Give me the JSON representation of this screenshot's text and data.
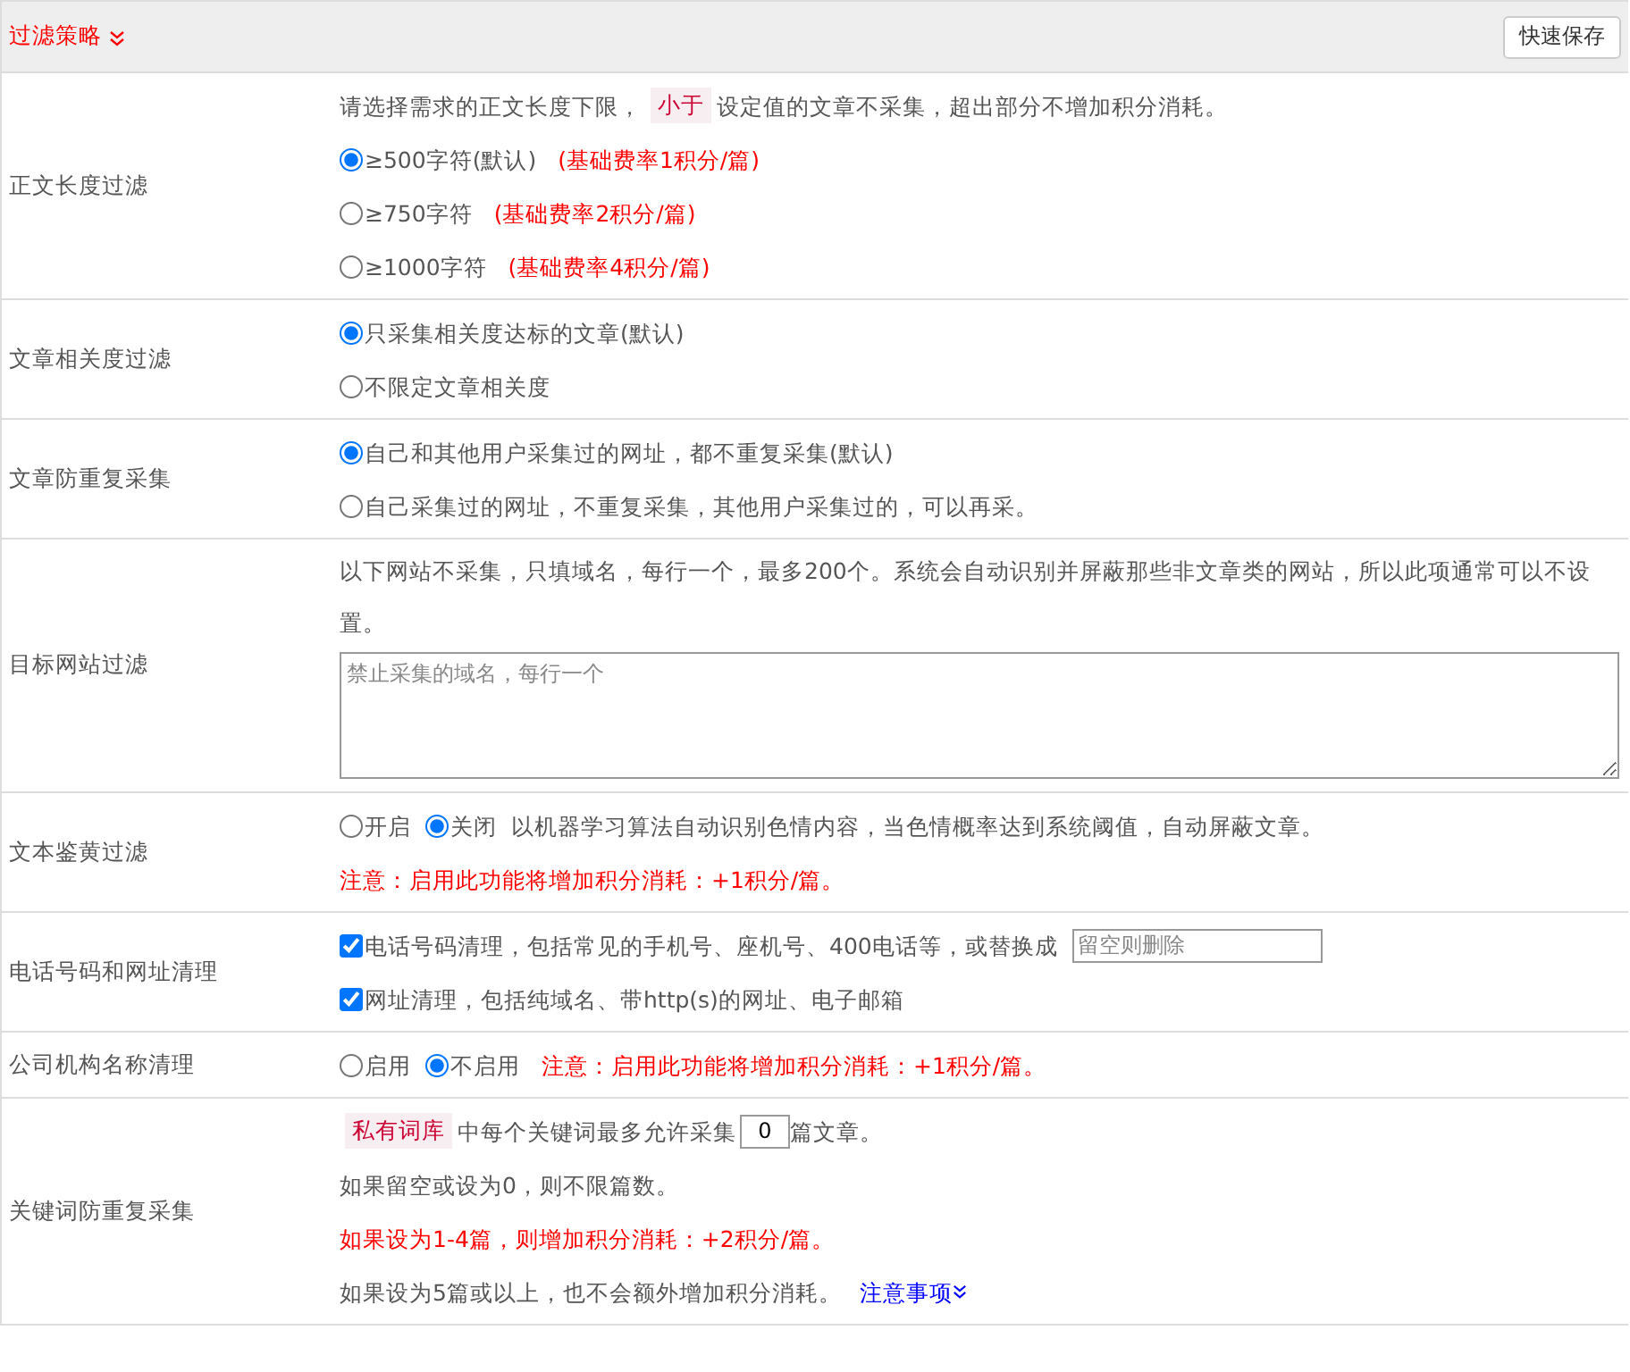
{
  "header": {
    "title": "过滤策略",
    "button": "快速保存"
  },
  "rows": [
    {
      "label": "正文长度过滤",
      "lines": [
        [
          {
            "kind": "text",
            "text": "请选择需求的正文长度下限，"
          },
          {
            "kind": "tag",
            "text": "小于"
          },
          {
            "kind": "text",
            "text": "设定值的文章不采集，超出部分不增加积分消耗。"
          }
        ],
        [
          {
            "kind": "radio",
            "text": "≥500字符(默认)",
            "selected": true
          },
          {
            "kind": "warning",
            "text": "(基础费率1积分/篇)"
          }
        ],
        [
          {
            "kind": "radio",
            "text": "≥750字符",
            "selected": false
          },
          {
            "kind": "warning",
            "text": "(基础费率2积分/篇)"
          }
        ],
        [
          {
            "kind": "radio",
            "text": "≥1000字符",
            "selected": false
          },
          {
            "kind": "warning",
            "text": "(基础费率4积分/篇)"
          }
        ]
      ]
    },
    {
      "label": "文章相关度过滤",
      "lines": [
        [
          {
            "kind": "radio",
            "text": "只采集相关度达标的文章(默认)",
            "selected": true
          }
        ],
        [
          {
            "kind": "radio",
            "text": "不限定文章相关度",
            "selected": false
          }
        ]
      ]
    },
    {
      "label": "文章防重复采集",
      "lines": [
        [
          {
            "kind": "radio",
            "text": "自己和其他用户采集过的网址，都不重复采集(默认)",
            "selected": true
          }
        ],
        [
          {
            "kind": "radio",
            "text": "自己采集过的网址，不重复采集，其他用户采集过的，可以再采。",
            "selected": false
          }
        ]
      ]
    },
    {
      "label": "目标网站过滤",
      "lines": [
        [
          {
            "kind": "text",
            "text": "以下网站不采集，只填域名，每行一个，最多200个。系统会自动识别并屏蔽那些非文章类的网站，所以此项通常可以不设置。"
          }
        ],
        [
          {
            "kind": "textarea",
            "placeholder": "禁止采集的域名，每行一个"
          }
        ]
      ]
    },
    {
      "label": "文本鉴黄过滤",
      "lines": [
        [
          {
            "kind": "radio",
            "text": "开启",
            "selected": false
          },
          {
            "kind": "radio",
            "text": "关闭",
            "selected": true
          },
          {
            "kind": "text",
            "text": "以机器学习算法自动识别色情内容，当色情概率达到系统阈值，自动屏蔽文章。"
          }
        ],
        [
          {
            "kind": "warning",
            "text": "注意：启用此功能将增加积分消耗：+1积分/篇。"
          }
        ]
      ]
    },
    {
      "label": "电话号码和网址清理",
      "lines": [
        [
          {
            "kind": "checkbox",
            "text": "电话号码清理，包括常见的手机号、座机号、400电话等，或替换成",
            "checked": true
          },
          {
            "kind": "input",
            "placeholder": "留空则删除"
          }
        ],
        [
          {
            "kind": "checkbox",
            "text": "网址清理，包括纯域名、带http(s)的网址、电子邮箱",
            "checked": true
          }
        ]
      ]
    },
    {
      "label": "公司机构名称清理",
      "lines": [
        [
          {
            "kind": "radio",
            "text": "启用",
            "selected": false
          },
          {
            "kind": "radio",
            "text": "不启用",
            "selected": true
          },
          {
            "kind": "warning",
            "text": "注意：启用此功能将增加积分消耗：+1积分/篇。"
          }
        ]
      ]
    },
    {
      "label": "关键词防重复采集",
      "lines": [
        [
          {
            "kind": "tag",
            "text": "私有词库"
          },
          {
            "kind": "text",
            "text": "中每个关键词最多允许采集"
          },
          {
            "kind": "number",
            "value": "0"
          },
          {
            "kind": "text",
            "text": "篇文章。"
          }
        ],
        [
          {
            "kind": "text",
            "text": "如果留空或设为0，则不限篇数。"
          }
        ],
        [
          {
            "kind": "warning",
            "text": "如果设为1-4篇，则增加积分消耗：+2积分/篇。"
          }
        ],
        [
          {
            "kind": "text",
            "text": "如果设为5篇或以上，也不会额外增加积分消耗。"
          },
          {
            "kind": "link",
            "text": "注意事项"
          }
        ]
      ]
    }
  ]
}
